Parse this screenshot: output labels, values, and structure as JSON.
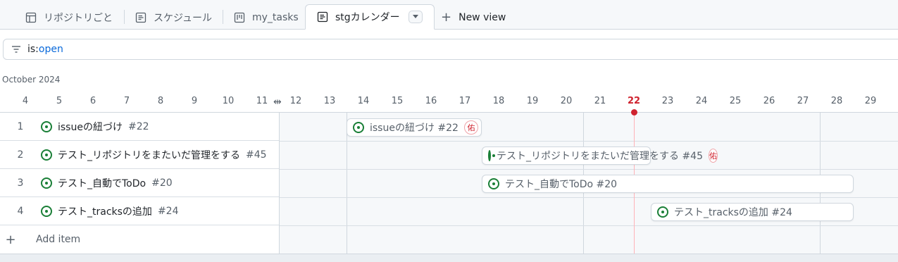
{
  "tabs": [
    {
      "label": "リポジトリごと",
      "icon": "table-icon"
    },
    {
      "label": "スケジュール",
      "icon": "roadmap-icon"
    },
    {
      "label": "my_tasks",
      "icon": "board-icon"
    },
    {
      "label": "stgカレンダー",
      "icon": "roadmap-icon",
      "active": true
    }
  ],
  "new_view_label": "New view",
  "filter": {
    "key": "is:",
    "value": "open"
  },
  "timeline": {
    "month": "October 2024",
    "days": [
      "4",
      "5",
      "6",
      "7",
      "8",
      "9",
      "10",
      "11",
      "12",
      "13",
      "14",
      "15",
      "16",
      "17",
      "18",
      "19",
      "20",
      "21",
      "22",
      "23",
      "24",
      "25",
      "26",
      "27",
      "28",
      "29"
    ],
    "today": "22"
  },
  "rows": [
    {
      "num": "1",
      "title": "issueの紐づけ",
      "issue_no": "#22"
    },
    {
      "num": "2",
      "title": "テスト_リポジトリをまたいだ管理をする",
      "issue_no": "#45"
    },
    {
      "num": "3",
      "title": "テスト_自動でToDo",
      "issue_no": "#20"
    },
    {
      "num": "4",
      "title": "テスト_tracksの追加",
      "issue_no": "#24"
    }
  ],
  "bars": [
    {
      "label": "issueの紐づけ #22",
      "avatar": "佑"
    },
    {
      "label": "テスト_リポジトリをまたいだ管理をする #45",
      "avatar": "佑"
    },
    {
      "label": "テスト_自動でToDo #20",
      "avatar": ""
    },
    {
      "label": "テスト_tracksの追加 #24",
      "avatar": ""
    }
  ],
  "add_item_label": "Add item",
  "colors": {
    "open_issue": "#1a7f37",
    "today": "#cf222e",
    "link": "#0969da"
  }
}
